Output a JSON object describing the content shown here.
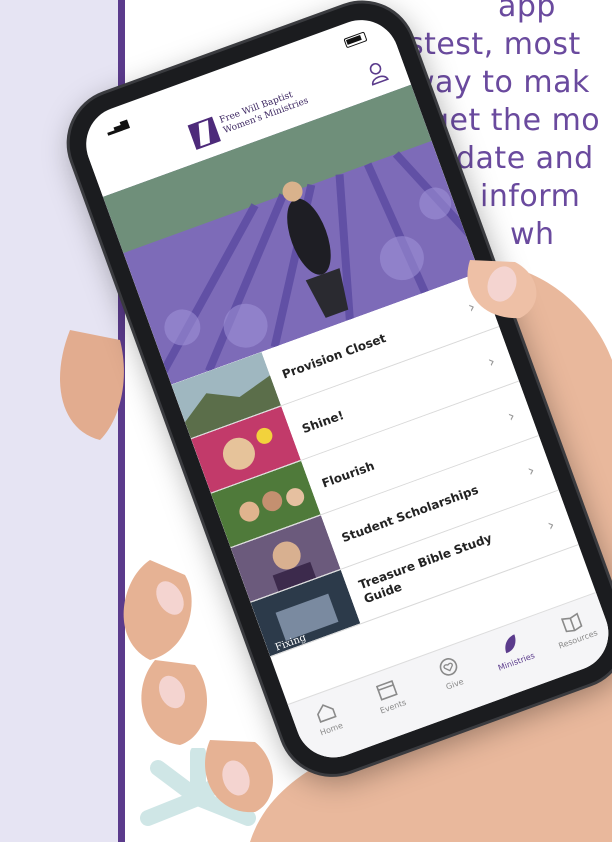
{
  "marketing": {
    "lines": [
      "app",
      "fastest, most",
      "way to mak",
      "get the mo",
      "date and",
      "inform",
      "wh"
    ]
  },
  "colors": {
    "panel": "#e6e4f3",
    "accent": "#5b3b8c",
    "copy": "#6a4a9e",
    "asterisk": "#cfe6e6"
  },
  "app": {
    "logo_line1": "Free Will Baptist",
    "logo_line2": "Women's Ministries",
    "profile_icon": "user-icon"
  },
  "menu": {
    "items": [
      {
        "label": "Provision Closet",
        "thumb": "coast-photo"
      },
      {
        "label": "Shine!",
        "thumb": "shine-photo"
      },
      {
        "label": "Flourish",
        "thumb": "flourish-photo"
      },
      {
        "label": "Student Scholarships",
        "thumb": "students-photo"
      },
      {
        "label": "Treasure Bible Study Guide",
        "thumb": "treasure-photo"
      }
    ]
  },
  "tabs": [
    {
      "label": "Home",
      "icon": "home-icon",
      "active": false
    },
    {
      "label": "Events",
      "icon": "calendar-icon",
      "active": false
    },
    {
      "label": "Give",
      "icon": "heart-icon",
      "active": false
    },
    {
      "label": "Ministries",
      "icon": "leaf-icon",
      "active": true
    },
    {
      "label": "Resources",
      "icon": "book-icon",
      "active": false
    }
  ],
  "partial_badge": "Fixing"
}
